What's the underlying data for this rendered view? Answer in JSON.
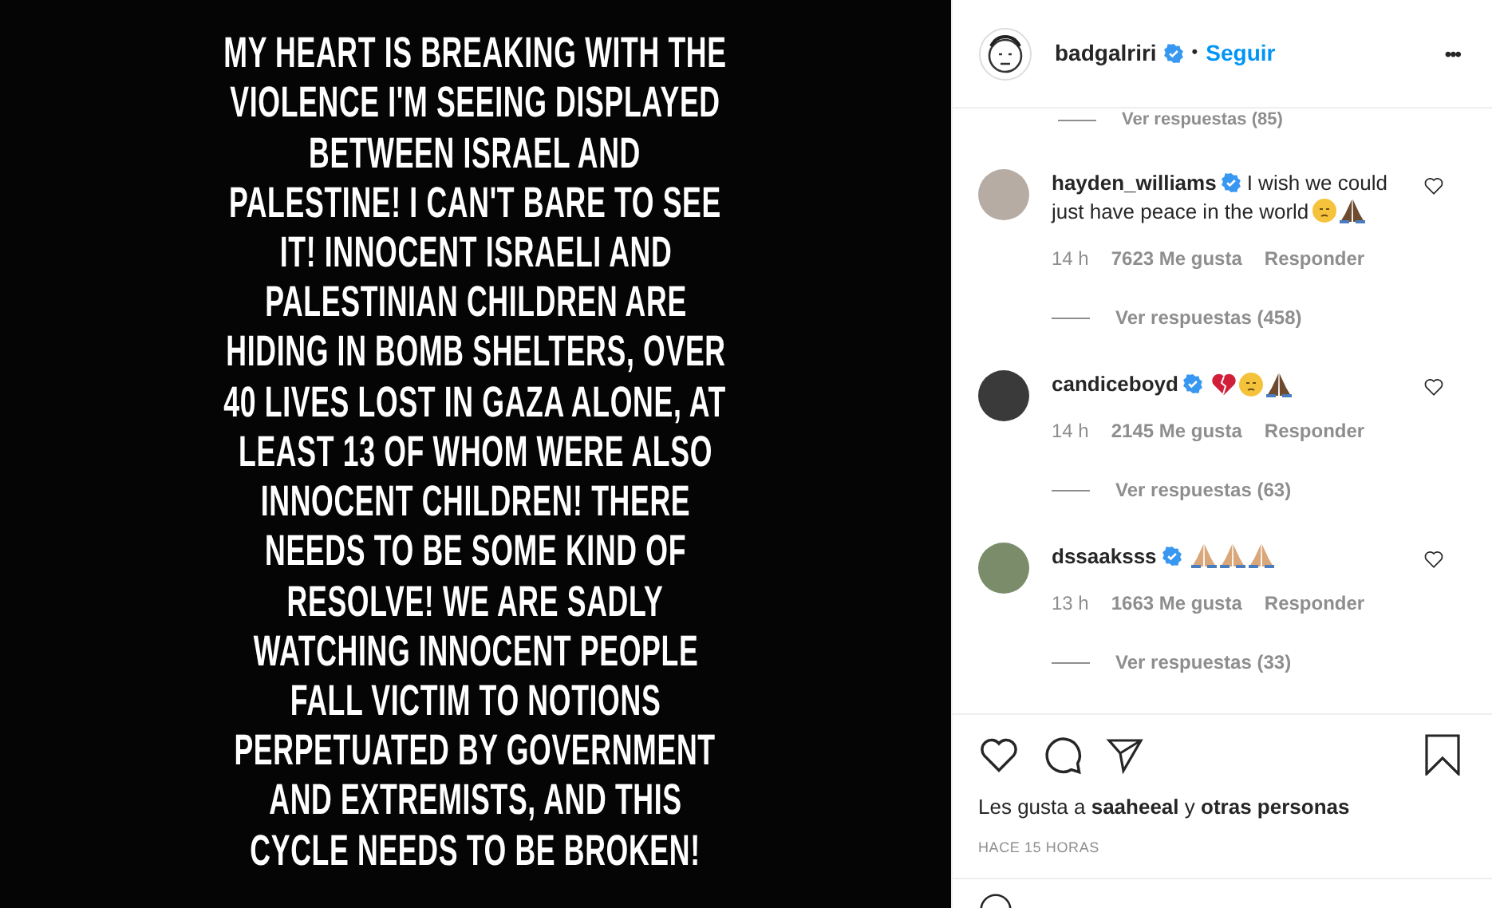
{
  "post_image": {
    "lines": [
      "MY HEART IS BREAKING WITH THE",
      "VIOLENCE I'M SEEING DISPLAYED",
      "BETWEEN ISRAEL AND",
      "PALESTINE! I CAN'T BARE TO SEE",
      "IT! INNOCENT ISRAELI AND",
      "PALESTINIAN CHILDREN ARE",
      "HIDING IN BOMB SHELTERS, OVER",
      "40 LIVES LOST IN GAZA ALONE, AT",
      "LEAST 13 OF WHOM WERE ALSO",
      "INNOCENT CHILDREN! THERE",
      "NEEDS TO BE SOME KIND OF",
      "RESOLVE! WE ARE SADLY",
      "WATCHING INNOCENT PEOPLE",
      "FALL VICTIM TO NOTIONS",
      "PERPETUATED BY GOVERNMENT",
      "AND EXTREMISTS, AND THIS",
      "CYCLE NEEDS TO BE BROKEN!"
    ]
  },
  "header": {
    "username": "badgalriri",
    "verified": true,
    "separator": "•",
    "follow": "Seguir",
    "more": "•••"
  },
  "partial_replies": "Ver respuestas (85)",
  "comments": [
    {
      "username": "hayden_williams",
      "verified": true,
      "text": "I wish we could just have peace in the world",
      "emojis": [
        {
          "kind": "sad"
        },
        {
          "kind": "pray-dark"
        }
      ],
      "time": "14 h",
      "likes": "7623 Me gusta",
      "reply": "Responder",
      "replies": "Ver respuestas (458)"
    },
    {
      "username": "candiceboyd",
      "verified": true,
      "emojis": [
        {
          "kind": "broken-heart"
        },
        {
          "kind": "sad"
        },
        {
          "kind": "pray-dark"
        }
      ],
      "time": "14 h",
      "likes": "2145 Me gusta",
      "reply": "Responder",
      "replies": "Ver respuestas (63)"
    },
    {
      "username": "dssaaksss",
      "verified": true,
      "emojis": [
        {
          "kind": "pray-light"
        },
        {
          "kind": "pray-light"
        },
        {
          "kind": "pray-light"
        }
      ],
      "time": "13 h",
      "likes": "1663 Me gusta",
      "reply": "Responder",
      "replies": "Ver respuestas (33)"
    }
  ],
  "likes_line": {
    "prefix": "Les gusta a",
    "user": "saaheeal",
    "middle": "y",
    "rest": "otras personas"
  },
  "posted": "HACE 15 HORAS"
}
